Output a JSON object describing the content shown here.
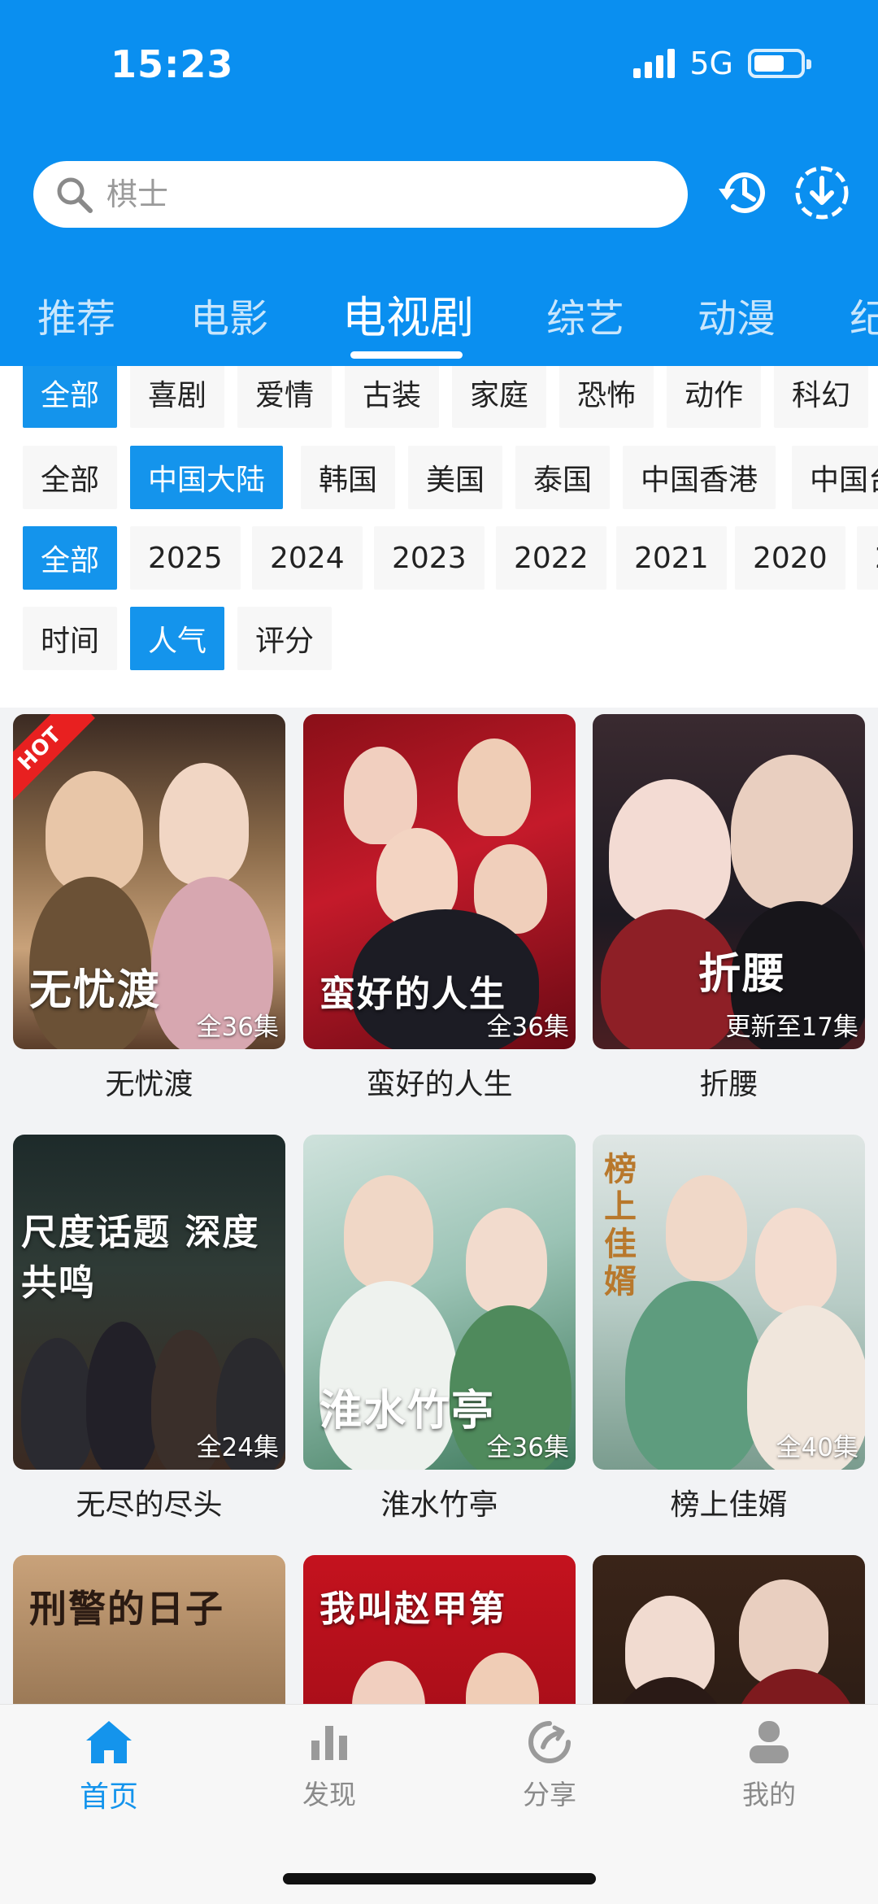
{
  "status": {
    "time": "15:23",
    "network": "5G"
  },
  "search": {
    "placeholder": "棋士"
  },
  "icons": {
    "search": "search-icon",
    "history": "history-icon",
    "download": "download-icon"
  },
  "category_tabs": [
    "推荐",
    "电影",
    "电视剧",
    "综艺",
    "动漫",
    "纪"
  ],
  "active_category": "电视剧",
  "filters": {
    "genre": [
      "全部",
      "喜剧",
      "爱情",
      "古装",
      "家庭",
      "恐怖",
      "动作",
      "科幻"
    ],
    "region": [
      "全部",
      "中国大陆",
      "韩国",
      "美国",
      "泰国",
      "中国香港",
      "中国台"
    ],
    "year": [
      "全部",
      "2025",
      "2024",
      "2023",
      "2022",
      "2021",
      "2020",
      "2"
    ],
    "sort": [
      "时间",
      "人气",
      "评分"
    ],
    "active": {
      "genre": "全部",
      "region": "中国大陆",
      "year": "全部",
      "sort": "人气"
    }
  },
  "shows": [
    {
      "title": "无忧渡",
      "badge": "全36集",
      "poster_text": "无忧渡",
      "hot": true,
      "hot_label": "HOT"
    },
    {
      "title": "蛮好的人生",
      "badge": "全36集",
      "poster_text": "蛮好的人生"
    },
    {
      "title": "折腰",
      "badge": "更新至17集",
      "poster_text": "折腰"
    },
    {
      "title": "无尽的尽头",
      "badge": "全24集",
      "poster_text": "尺度话题 深度共鸣"
    },
    {
      "title": "淮水竹亭",
      "badge": "全36集",
      "poster_text": "淮水竹亭"
    },
    {
      "title": "榜上佳婿",
      "badge": "全40集",
      "poster_text": "榜上佳婿"
    },
    {
      "title": "",
      "badge": "",
      "poster_text": "刑警的日子"
    },
    {
      "title": "",
      "badge": "",
      "poster_text": "我叫赵甲第"
    },
    {
      "title": "",
      "badge": "",
      "poster_text": ""
    }
  ],
  "bottom_nav": [
    {
      "label": "首页",
      "icon": "home-icon",
      "active": true
    },
    {
      "label": "发现",
      "icon": "bar-chart-icon",
      "active": false
    },
    {
      "label": "分享",
      "icon": "share-icon",
      "active": false
    },
    {
      "label": "我的",
      "icon": "profile-icon",
      "active": false
    }
  ],
  "colors": {
    "primary": "#0a8ff0",
    "chip_active": "#1494ec",
    "hot": "#e82020"
  }
}
